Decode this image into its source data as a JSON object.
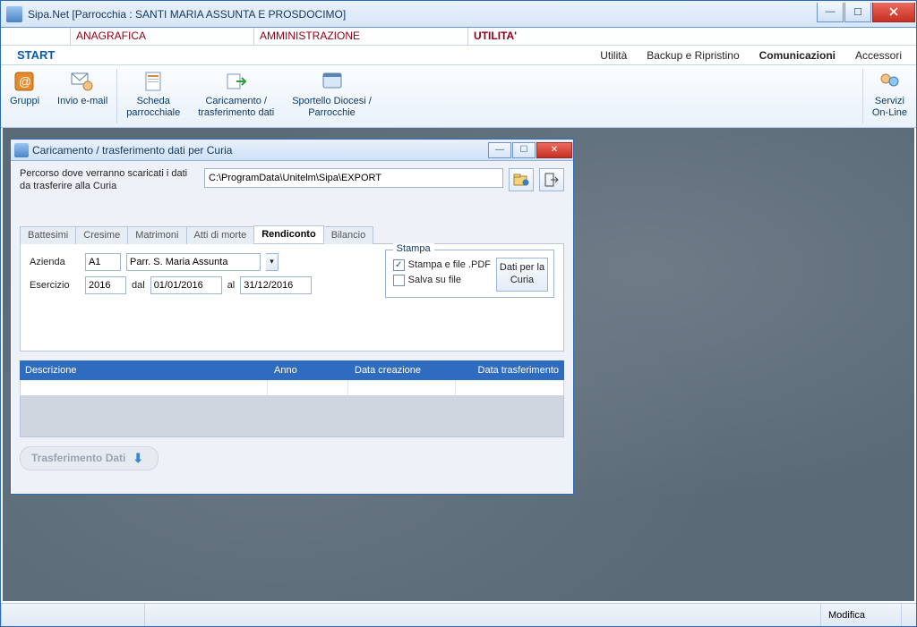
{
  "window": {
    "title": "Sipa.Net  [Parrocchia : SANTI MARIA ASSUNTA E PROSDOCIMO]"
  },
  "main_menu": {
    "anagrafica": "ANAGRAFICA",
    "amministrazione": "AMMINISTRAZIONE",
    "utilita": "UTILITA'"
  },
  "start_label": "START",
  "sub_menu": {
    "utilita": "Utilità",
    "backup": "Backup e Ripristino",
    "comunicazioni": "Comunicazioni",
    "accessori": "Accessori"
  },
  "ribbon": {
    "gruppi": "Gruppi",
    "invio_email": "Invio e-mail",
    "scheda_l1": "Scheda",
    "scheda_l2": "parrocchiale",
    "caricamento_l1": "Caricamento /",
    "caricamento_l2": "trasferimento dati",
    "sportello_l1": "Sportello Diocesi /",
    "sportello_l2": "Parrocchie",
    "servizi_l1": "Servizi",
    "servizi_l2": "On-Line"
  },
  "child": {
    "title": "Caricamento / trasferimento dati per Curia",
    "path_label": "Percorso dove verranno scaricati i dati da trasferire alla Curia",
    "path_value": "C:\\ProgramData\\Unitelm\\Sipa\\EXPORT",
    "tabs": {
      "battesimi": "Battesimi",
      "cresime": "Cresime",
      "matrimoni": "Matrimoni",
      "atti": "Atti di morte",
      "rendiconto": "Rendiconto",
      "bilancio": "Bilancio"
    },
    "form": {
      "azienda_lbl": "Azienda",
      "azienda_code": "A1",
      "azienda_name": "Parr. S. Maria Assunta",
      "esercizio_lbl": "Esercizio",
      "esercizio_val": "2016",
      "dal_lbl": "dal",
      "dal_val": "01/01/2016",
      "al_lbl": "al",
      "al_val": "31/12/2016"
    },
    "stampa": {
      "legend": "Stampa",
      "stampa_pdf": "Stampa e file .PDF",
      "salva_file": "Salva su file",
      "dati_btn": "Dati per la Curia"
    },
    "grid": {
      "descrizione": "Descrizione",
      "anno": "Anno",
      "data_creazione": "Data creazione",
      "data_trasf": "Data trasferimento"
    },
    "transfer_btn": "Trasferimento Dati"
  },
  "status": {
    "modifica": "Modifica"
  }
}
